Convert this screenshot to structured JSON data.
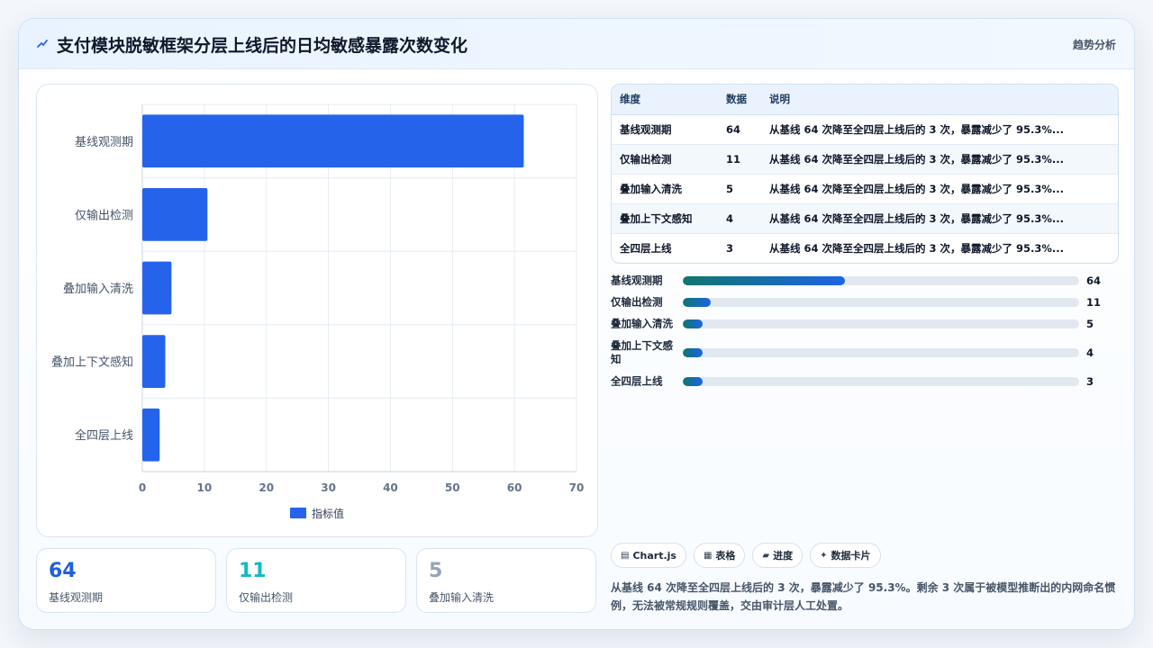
{
  "header": {
    "title": "支付模块脱敏框架分层上线后的日均敏感暴露次数变化",
    "tag": "趋势分析"
  },
  "chart_data": {
    "type": "bar",
    "orientation": "horizontal",
    "categories": [
      "基线观测期",
      "仅输出检测",
      "叠加输入清洗",
      "叠加上下文感知",
      "全四层上线"
    ],
    "series": [
      {
        "name": "指标值",
        "values": [
          61.5,
          10.5,
          4.7,
          3.7,
          2.8
        ],
        "color": "#2563eb"
      }
    ],
    "x_ticks": [
      "0",
      "10",
      "20",
      "30",
      "40",
      "50",
      "60",
      "70"
    ],
    "xlim": [
      0,
      70
    ],
    "grid": true,
    "legend_position": "bottom"
  },
  "kpis": [
    {
      "value": "64",
      "label": "基线观测期",
      "color": "#1d5fe0"
    },
    {
      "value": "11",
      "label": "仅输出检测",
      "color": "#14b8c6"
    },
    {
      "value": "5",
      "label": "叠加输入清洗",
      "color": "#94a3b8"
    }
  ],
  "table": {
    "headers": [
      "维度",
      "数据",
      "说明"
    ],
    "rows": [
      [
        "基线观测期",
        "64",
        "从基线 64 次降至全四层上线后的 3 次，暴露减少了 95.3%..."
      ],
      [
        "仅输出检测",
        "11",
        "从基线 64 次降至全四层上线后的 3 次，暴露减少了 95.3%..."
      ],
      [
        "叠加输入清洗",
        "5",
        "从基线 64 次降至全四层上线后的 3 次，暴露减少了 95.3%..."
      ],
      [
        "叠加上下文感知",
        "4",
        "从基线 64 次降至全四层上线后的 3 次，暴露减少了 95.3%..."
      ],
      [
        "全四层上线",
        "3",
        "从基线 64 次降至全四层上线后的 3 次，暴露减少了 95.3%..."
      ]
    ]
  },
  "progress": [
    {
      "label": "基线观测期",
      "value": "64",
      "fraction": 0.41
    },
    {
      "label": "仅输出检测",
      "value": "11",
      "fraction": 0.07
    },
    {
      "label": "叠加输入清洗",
      "value": "5",
      "fraction": 0.05
    },
    {
      "label": "叠加上下文感知",
      "value": "4",
      "fraction": 0.05
    },
    {
      "label": "全四层上线",
      "value": "3",
      "fraction": 0.05
    }
  ],
  "chips": [
    {
      "icon": "▤",
      "label": "Chart.js"
    },
    {
      "icon": "▦",
      "label": "表格"
    },
    {
      "icon": "▰",
      "label": "进度"
    },
    {
      "icon": "✦",
      "label": "数据卡片"
    }
  ],
  "summary": "从基线 64 次降至全四层上线后的 3 次，暴露减少了 95.3%。剩余 3 次属于被模型推断出的内网命名惯例，无法被常规规则覆盖，交由审计层人工处置。"
}
